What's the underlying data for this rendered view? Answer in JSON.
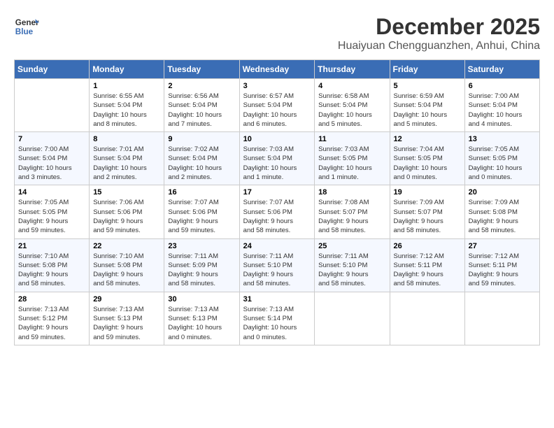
{
  "header": {
    "logo_line1": "General",
    "logo_line2": "Blue",
    "month_title": "December 2025",
    "location": "Huaiyuan Chengguanzhen, Anhui, China"
  },
  "days_of_week": [
    "Sunday",
    "Monday",
    "Tuesday",
    "Wednesday",
    "Thursday",
    "Friday",
    "Saturday"
  ],
  "weeks": [
    [
      {
        "day": "",
        "info": ""
      },
      {
        "day": "1",
        "info": "Sunrise: 6:55 AM\nSunset: 5:04 PM\nDaylight: 10 hours\nand 8 minutes."
      },
      {
        "day": "2",
        "info": "Sunrise: 6:56 AM\nSunset: 5:04 PM\nDaylight: 10 hours\nand 7 minutes."
      },
      {
        "day": "3",
        "info": "Sunrise: 6:57 AM\nSunset: 5:04 PM\nDaylight: 10 hours\nand 6 minutes."
      },
      {
        "day": "4",
        "info": "Sunrise: 6:58 AM\nSunset: 5:04 PM\nDaylight: 10 hours\nand 5 minutes."
      },
      {
        "day": "5",
        "info": "Sunrise: 6:59 AM\nSunset: 5:04 PM\nDaylight: 10 hours\nand 5 minutes."
      },
      {
        "day": "6",
        "info": "Sunrise: 7:00 AM\nSunset: 5:04 PM\nDaylight: 10 hours\nand 4 minutes."
      }
    ],
    [
      {
        "day": "7",
        "info": "Sunrise: 7:00 AM\nSunset: 5:04 PM\nDaylight: 10 hours\nand 3 minutes."
      },
      {
        "day": "8",
        "info": "Sunrise: 7:01 AM\nSunset: 5:04 PM\nDaylight: 10 hours\nand 2 minutes."
      },
      {
        "day": "9",
        "info": "Sunrise: 7:02 AM\nSunset: 5:04 PM\nDaylight: 10 hours\nand 2 minutes."
      },
      {
        "day": "10",
        "info": "Sunrise: 7:03 AM\nSunset: 5:04 PM\nDaylight: 10 hours\nand 1 minute."
      },
      {
        "day": "11",
        "info": "Sunrise: 7:03 AM\nSunset: 5:05 PM\nDaylight: 10 hours\nand 1 minute."
      },
      {
        "day": "12",
        "info": "Sunrise: 7:04 AM\nSunset: 5:05 PM\nDaylight: 10 hours\nand 0 minutes."
      },
      {
        "day": "13",
        "info": "Sunrise: 7:05 AM\nSunset: 5:05 PM\nDaylight: 10 hours\nand 0 minutes."
      }
    ],
    [
      {
        "day": "14",
        "info": "Sunrise: 7:05 AM\nSunset: 5:05 PM\nDaylight: 9 hours\nand 59 minutes."
      },
      {
        "day": "15",
        "info": "Sunrise: 7:06 AM\nSunset: 5:06 PM\nDaylight: 9 hours\nand 59 minutes."
      },
      {
        "day": "16",
        "info": "Sunrise: 7:07 AM\nSunset: 5:06 PM\nDaylight: 9 hours\nand 59 minutes."
      },
      {
        "day": "17",
        "info": "Sunrise: 7:07 AM\nSunset: 5:06 PM\nDaylight: 9 hours\nand 58 minutes."
      },
      {
        "day": "18",
        "info": "Sunrise: 7:08 AM\nSunset: 5:07 PM\nDaylight: 9 hours\nand 58 minutes."
      },
      {
        "day": "19",
        "info": "Sunrise: 7:09 AM\nSunset: 5:07 PM\nDaylight: 9 hours\nand 58 minutes."
      },
      {
        "day": "20",
        "info": "Sunrise: 7:09 AM\nSunset: 5:08 PM\nDaylight: 9 hours\nand 58 minutes."
      }
    ],
    [
      {
        "day": "21",
        "info": "Sunrise: 7:10 AM\nSunset: 5:08 PM\nDaylight: 9 hours\nand 58 minutes."
      },
      {
        "day": "22",
        "info": "Sunrise: 7:10 AM\nSunset: 5:08 PM\nDaylight: 9 hours\nand 58 minutes."
      },
      {
        "day": "23",
        "info": "Sunrise: 7:11 AM\nSunset: 5:09 PM\nDaylight: 9 hours\nand 58 minutes."
      },
      {
        "day": "24",
        "info": "Sunrise: 7:11 AM\nSunset: 5:10 PM\nDaylight: 9 hours\nand 58 minutes."
      },
      {
        "day": "25",
        "info": "Sunrise: 7:11 AM\nSunset: 5:10 PM\nDaylight: 9 hours\nand 58 minutes."
      },
      {
        "day": "26",
        "info": "Sunrise: 7:12 AM\nSunset: 5:11 PM\nDaylight: 9 hours\nand 58 minutes."
      },
      {
        "day": "27",
        "info": "Sunrise: 7:12 AM\nSunset: 5:11 PM\nDaylight: 9 hours\nand 59 minutes."
      }
    ],
    [
      {
        "day": "28",
        "info": "Sunrise: 7:13 AM\nSunset: 5:12 PM\nDaylight: 9 hours\nand 59 minutes."
      },
      {
        "day": "29",
        "info": "Sunrise: 7:13 AM\nSunset: 5:13 PM\nDaylight: 9 hours\nand 59 minutes."
      },
      {
        "day": "30",
        "info": "Sunrise: 7:13 AM\nSunset: 5:13 PM\nDaylight: 10 hours\nand 0 minutes."
      },
      {
        "day": "31",
        "info": "Sunrise: 7:13 AM\nSunset: 5:14 PM\nDaylight: 10 hours\nand 0 minutes."
      },
      {
        "day": "",
        "info": ""
      },
      {
        "day": "",
        "info": ""
      },
      {
        "day": "",
        "info": ""
      }
    ]
  ]
}
